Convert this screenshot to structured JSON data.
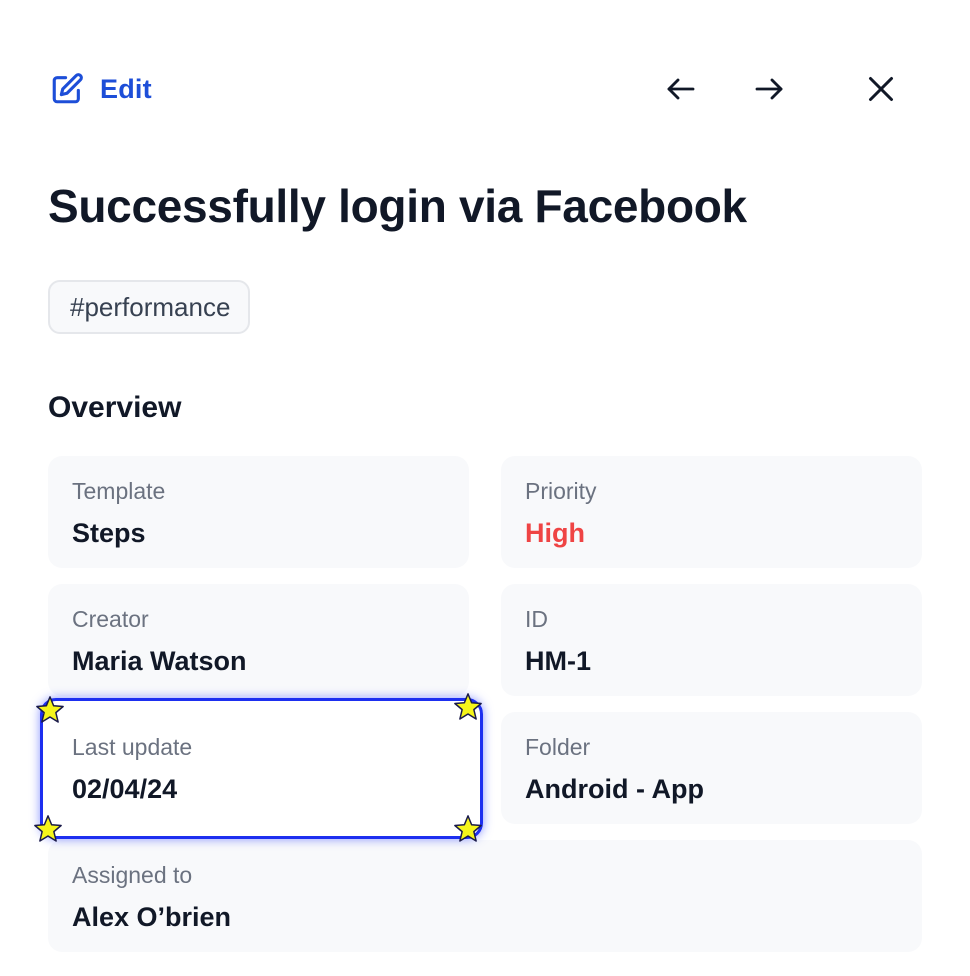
{
  "header": {
    "edit_label": "Edit",
    "edit_icon": "edit-icon",
    "prev_icon": "arrow-left-icon",
    "next_icon": "arrow-right-icon",
    "close_icon": "close-icon"
  },
  "title": "Successfully login via Facebook",
  "tag": "#performance",
  "overview": {
    "heading": "Overview",
    "template": {
      "label": "Template",
      "value": "Steps"
    },
    "priority": {
      "label": "Priority",
      "value": "High",
      "color": "#ef4444"
    },
    "creator": {
      "label": "Creator",
      "value": "Maria Watson"
    },
    "id": {
      "label": "ID",
      "value": "HM-1"
    },
    "last_update": {
      "label": "Last update",
      "value": "02/04/24"
    },
    "folder": {
      "label": "Folder",
      "value": "Android - App"
    },
    "assigned_to": {
      "label": "Assigned to",
      "value": "Alex O’brien"
    }
  },
  "colors": {
    "accent": "#1d4ed8",
    "highlight": "#1d2ff0",
    "star_fill": "#f5f51a"
  }
}
